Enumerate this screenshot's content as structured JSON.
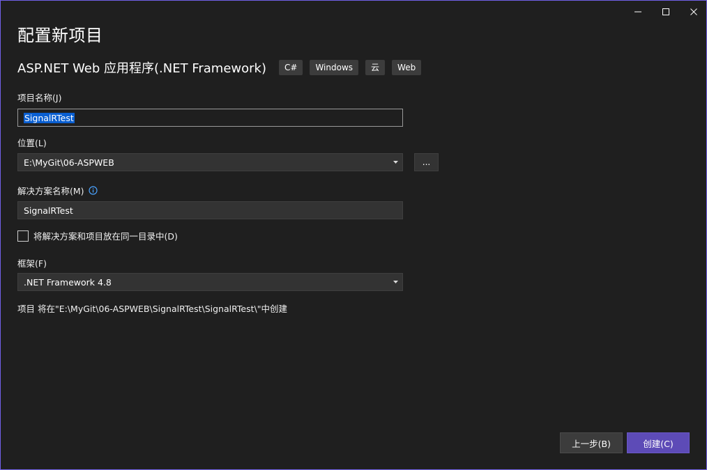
{
  "dialog": {
    "title": "配置新项目",
    "template_name": "ASP.NET Web 应用程序(.NET Framework)",
    "tags": [
      "C#",
      "Windows",
      "云",
      "Web"
    ]
  },
  "form": {
    "project_name": {
      "label": "项目名称(J)",
      "value": "SignalRTest"
    },
    "location": {
      "label": "位置(L)",
      "value": "E:\\MyGit\\06-ASPWEB",
      "browse_label": "..."
    },
    "solution_name": {
      "label": "解决方案名称(M)",
      "value": "SignalRTest"
    },
    "same_directory": {
      "label": "将解决方案和项目放在同一目录中(D)",
      "checked": false
    },
    "framework": {
      "label": "框架(F)",
      "value": ".NET Framework 4.8"
    },
    "path_info": "项目 将在\"E:\\MyGit\\06-ASPWEB\\SignalRTest\\SignalRTest\\\"中创建"
  },
  "footer": {
    "back_label": "上一步(B)",
    "create_label": "创建(C)"
  },
  "colors": {
    "background": "#1f1f1f",
    "accent": "#5d4bb7",
    "selection": "#0a5fd1",
    "border_accent": "#7160e8"
  },
  "icons": {
    "minimize": "minimize-icon",
    "maximize": "maximize-icon",
    "close": "close-icon",
    "info": "info-icon",
    "dropdown": "chevron-down-icon"
  }
}
